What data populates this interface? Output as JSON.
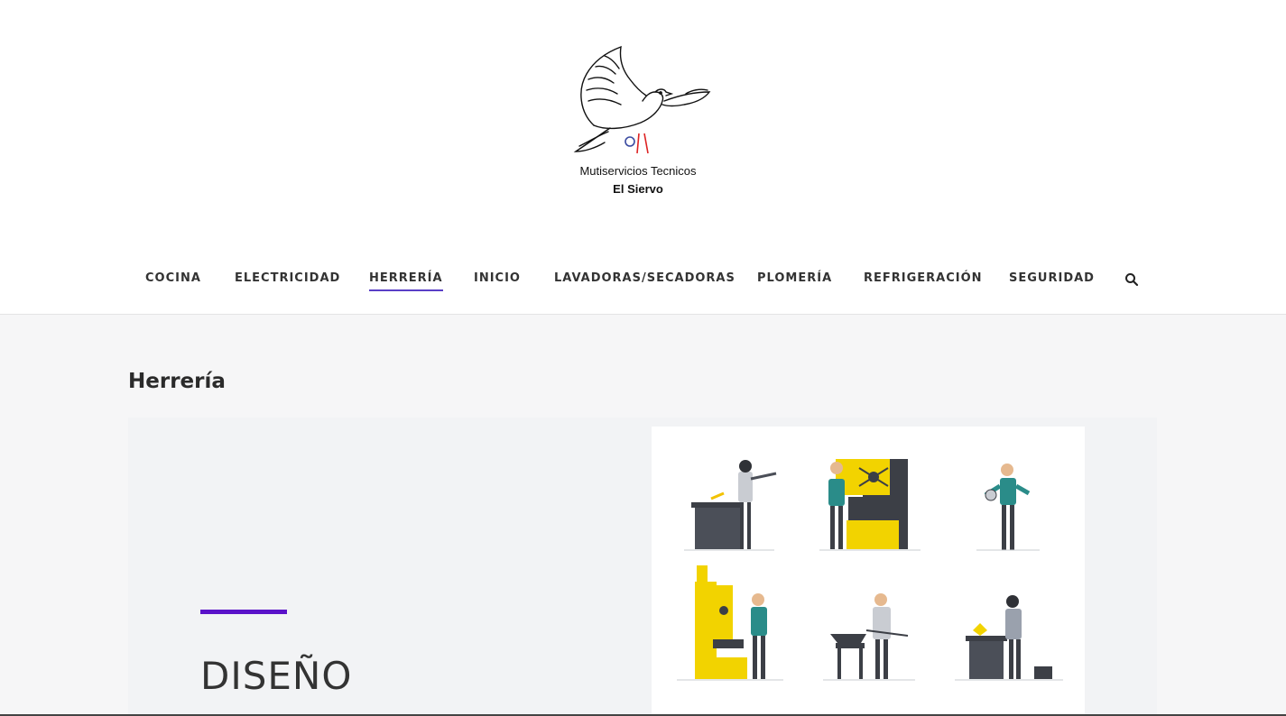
{
  "brand": {
    "line1": "Mutiservicios Tecnicos",
    "line2": "El Siervo"
  },
  "nav": {
    "items": [
      {
        "label": "COCINA"
      },
      {
        "label": "ELECTRICIDAD"
      },
      {
        "label": "HERRERÍA",
        "active": true
      },
      {
        "label": "INICIO"
      },
      {
        "label": "LAVADORAS/SECADORAS"
      },
      {
        "label": "PLOMERÍA"
      },
      {
        "label": "REFRIGERACIÓN"
      },
      {
        "label": "SEGURIDAD"
      }
    ],
    "search_icon": "search-icon",
    "active_color": "#5a3fc7"
  },
  "page": {
    "title": "Herrería"
  },
  "hero": {
    "title": "DISEÑO",
    "accent_color": "#5a12c9"
  }
}
